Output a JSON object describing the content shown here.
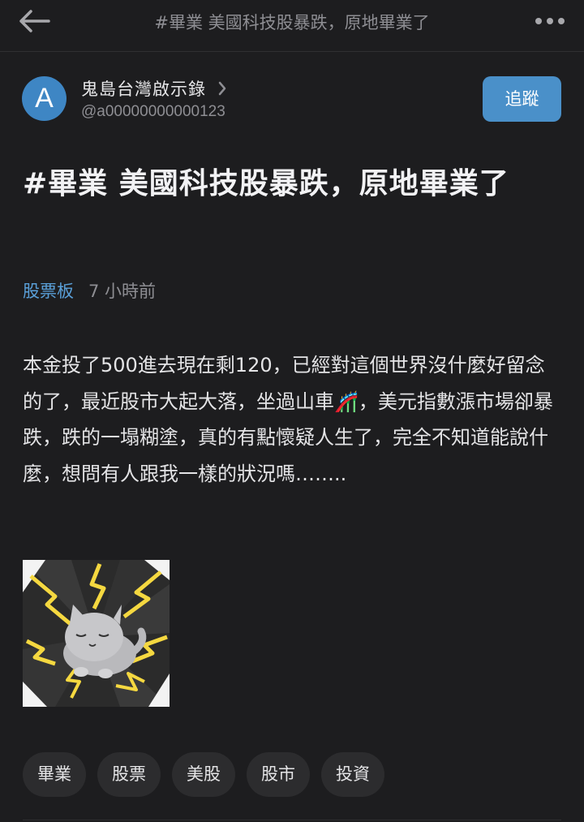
{
  "topbar": {
    "back_icon": "arrow-left-icon",
    "title": "#畢業 美國科技股暴跌，原地畢業了",
    "more_icon": "more-dots-icon"
  },
  "author": {
    "avatar_letter": "A",
    "avatar_color": "#3e86c4",
    "name": "鬼島台灣啟示錄",
    "handle": "@a00000000000123",
    "follow_label": "追蹤",
    "follow_color": "#4a90c9"
  },
  "post": {
    "title": "#畢業 美國科技股暴跌，原地畢業了",
    "board": "股票板",
    "board_color": "#5aa0d9",
    "time": "7 小時前",
    "body_part1": "本金投了500進去現在剩120，已經對這個世界沒什麼好留念的了，最近股市大起大落，坐過山車",
    "body_emoji": "🎢",
    "body_part2": "，美元指數漲市場卻暴跌，跌的一塌糊塗，真的有點懷疑人生了，完全不知道能說什麼，想問有人跟我一樣的狀況嗎……..",
    "image": "gray-cat-sticker-lightning"
  },
  "tags": [
    "畢業",
    "股票",
    "美股",
    "股市",
    "投資"
  ]
}
